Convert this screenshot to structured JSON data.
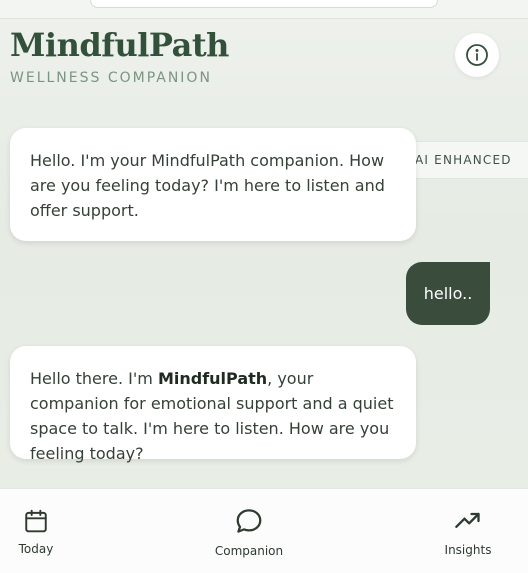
{
  "header": {
    "title": "MindfulPath",
    "subtitle": "WELLNESS COMPANION"
  },
  "ai_tab": {
    "label": "AI ENHANCED"
  },
  "messages": [
    {
      "role": "assistant",
      "text": "Hello. I'm your MindfulPath companion. How are you feeling today? I'm here to listen and offer support."
    },
    {
      "role": "user",
      "text": "hello.."
    },
    {
      "role": "assistant",
      "text_before": "Hello there. I'm ",
      "text_bold": "MindfulPath",
      "text_after": ", your companion for emotional support and a quiet space to talk. I'm here to listen. How are you feeling today?"
    }
  ],
  "nav": {
    "items": [
      {
        "label": "Today",
        "icon": "calendar-icon"
      },
      {
        "label": "Companion",
        "icon": "chat-bubble-icon"
      },
      {
        "label": "Insights",
        "icon": "trending-up-icon"
      }
    ]
  },
  "colors": {
    "brand": "#33503a",
    "user_bubble": "#3a4d3c",
    "background": "#e9eee7"
  }
}
